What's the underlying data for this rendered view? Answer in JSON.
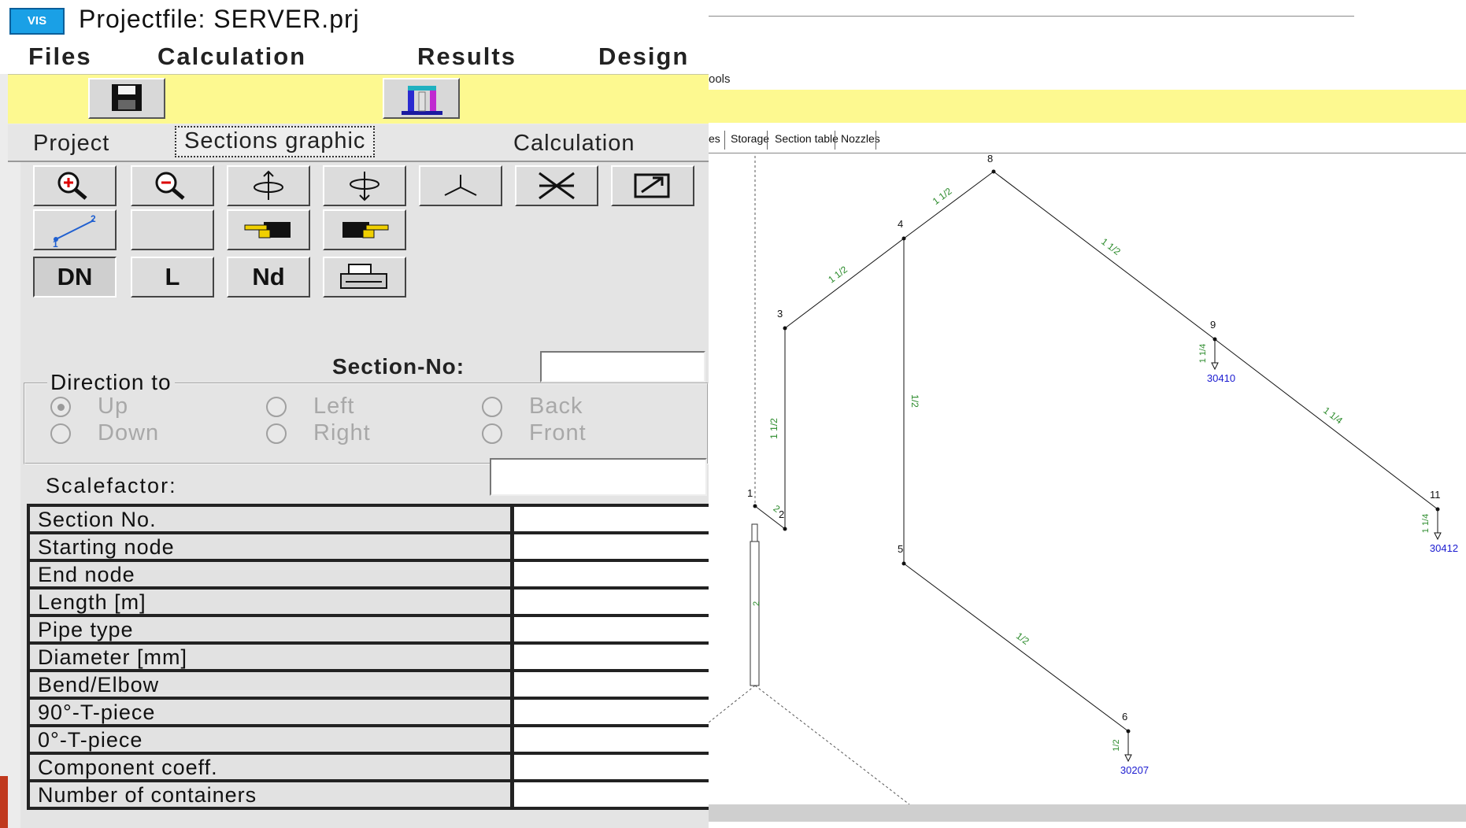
{
  "window": {
    "title": "Projectfile: SERVER.prj",
    "logo_text": "VIS"
  },
  "menu": [
    "Files",
    "Calculation",
    "Results",
    "Design"
  ],
  "toolbar": {
    "buttons": [
      "save-icon",
      "tower-icon"
    ]
  },
  "tabs": {
    "project": "Project",
    "sections_graphic": "Sections graphic",
    "calculation": "Calculation"
  },
  "graphic_buttons": {
    "row1": [
      "zoom-in-icon",
      "zoom-out-icon",
      "rotate-up-icon",
      "rotate-down-icon",
      "axes-icon",
      "fit-icon",
      "resize-icon"
    ],
    "row2": [
      "measure-icon",
      "blank",
      "hand-left-icon",
      "hand-right-icon"
    ],
    "row3_labels": {
      "dn": "DN",
      "l": "L",
      "nd": "Nd"
    },
    "print": "printer-icon"
  },
  "section_no": {
    "label": "Section-No:",
    "value": ""
  },
  "direction": {
    "legend": "Direction to",
    "options": {
      "up": "Up",
      "down": "Down",
      "left": "Left",
      "right": "Right",
      "back": "Back",
      "front": "Front"
    },
    "selected": "up"
  },
  "scalefactor": {
    "label": "Scalefactor:",
    "value": ""
  },
  "properties": [
    "Section No.",
    "Starting node",
    "End node",
    "Length [m]",
    "Pipe type",
    "Diameter [mm]",
    "Bend/Elbow",
    "90°-T-piece",
    "0°-T-piece",
    "Component coeff.",
    "Number of containers"
  ],
  "right_menu_fragment": "ools",
  "right_tabs": [
    "es",
    "Storage",
    "Section table",
    "Nozzles"
  ],
  "pipe_graph": {
    "nodes": [
      {
        "id": "1"
      },
      {
        "id": "2"
      },
      {
        "id": "3"
      },
      {
        "id": "4"
      },
      {
        "id": "5"
      },
      {
        "id": "6"
      },
      {
        "id": "8"
      },
      {
        "id": "9"
      },
      {
        "id": "11"
      }
    ],
    "sections": [
      {
        "from": "1",
        "to": "2",
        "size": "2"
      },
      {
        "from": "2",
        "to": "3",
        "size": "1 1/2"
      },
      {
        "from": "3",
        "to": "4",
        "size": "1 1/2"
      },
      {
        "from": "4",
        "to": "8",
        "size": "1 1/2"
      },
      {
        "from": "8",
        "to": "9",
        "size": "1 1/2"
      },
      {
        "from": "9",
        "to": "11",
        "size": "1 1/4"
      },
      {
        "from": "4",
        "to": "5",
        "size": "1/2"
      },
      {
        "from": "5",
        "to": "6",
        "size": "1/2"
      }
    ],
    "riser_size": "2",
    "outlets": [
      {
        "node": "9",
        "size": "1 1/4",
        "code": "30410"
      },
      {
        "node": "11",
        "size": "1 1/4",
        "code": "30412"
      },
      {
        "node": "6",
        "size": "1/2",
        "code": "30207"
      }
    ]
  }
}
